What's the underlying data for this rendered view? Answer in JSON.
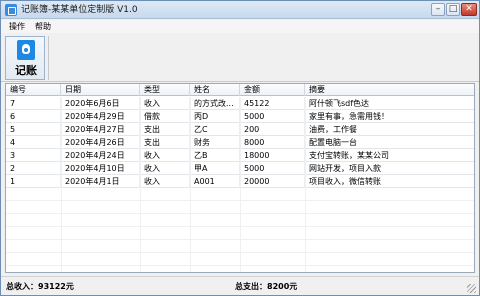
{
  "window": {
    "title": "记账簿-某某单位定制版 V1.0",
    "controls": {
      "minimize": "–",
      "maximize": "□",
      "close": "✕"
    }
  },
  "menu": {
    "items": [
      "操作",
      "帮助"
    ]
  },
  "toolbar": {
    "record_label": "记账",
    "record_icon": "money-bag-icon"
  },
  "table": {
    "columns": [
      "编号",
      "日期",
      "类型",
      "姓名",
      "金额",
      "摘要"
    ],
    "rows": [
      [
        "7",
        "2020年6月6日",
        "收入",
        "的方式改...",
        "45122",
        "阿什顿飞sdf色达"
      ],
      [
        "6",
        "2020年4月29日",
        "借款",
        "丙D",
        "5000",
        "家里有事，急需用钱！"
      ],
      [
        "5",
        "2020年4月27日",
        "支出",
        "乙C",
        "200",
        "油费，工作餐"
      ],
      [
        "4",
        "2020年4月26日",
        "支出",
        "财务",
        "8000",
        "配置电脑一台"
      ],
      [
        "3",
        "2020年4月24日",
        "收入",
        "乙B",
        "18000",
        "支付宝转账，某某公司"
      ],
      [
        "2",
        "2020年4月10日",
        "收入",
        "甲A",
        "5000",
        "网站开发，项目入款"
      ],
      [
        "1",
        "2020年4月1日",
        "收入",
        "A001",
        "20000",
        "项目收入，微信转账"
      ]
    ]
  },
  "status": {
    "income": "总收入：93122元",
    "expense": "总支出：8200元"
  },
  "colors": {
    "accent": "#1e88e5",
    "close": "#c0392b"
  }
}
